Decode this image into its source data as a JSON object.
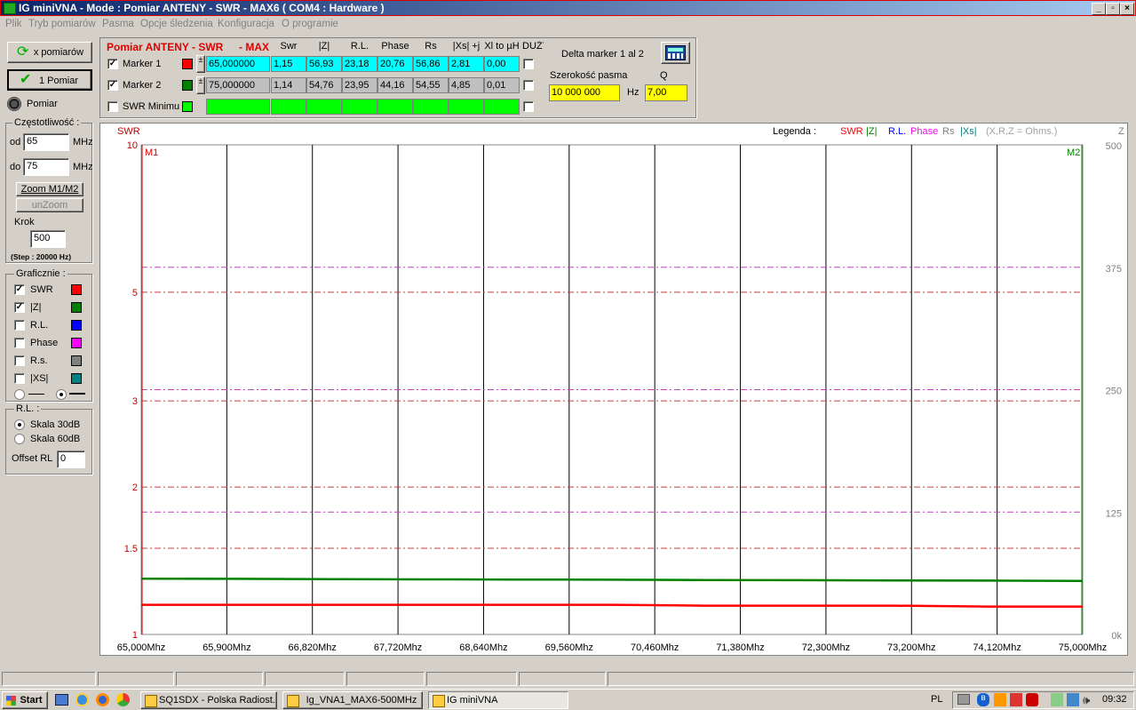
{
  "window": {
    "title": "IG miniVNA - Mode : Pomiar ANTENY - SWR    - MAX6 ( COM4 : Hardware )"
  },
  "menu": [
    "Plik",
    "Tryb pomiarów",
    "Pasma",
    "Opcje śledzenia",
    "Konfiguracja",
    "O programie"
  ],
  "left": {
    "x_pomiarow": "x pomiarów",
    "one_pomiar": "1 Pomiar",
    "pomiar": "Pomiar",
    "freq_title": "Częstotliwość :",
    "od_label": "od",
    "od_value": "65",
    "od_unit": "MHz",
    "do_label": "do",
    "do_value": "75",
    "do_unit": "MHz",
    "zoom": "Zoom M1/M2",
    "unzoom": "unZoom",
    "krok_label": "Krok",
    "krok_value": "500",
    "step_text": "(Step : 20000 Hz)",
    "graph_title": "Graficznie :",
    "graph_items": [
      {
        "label": "SWR",
        "checked": true,
        "color": "#ff0000"
      },
      {
        "label": "|Z|",
        "checked": true,
        "color": "#008000"
      },
      {
        "label": "R.L.",
        "checked": false,
        "color": "#0000ff"
      },
      {
        "label": "Phase",
        "checked": false,
        "color": "#ff00ff"
      },
      {
        "label": "R.s.",
        "checked": false,
        "color": "#808080"
      },
      {
        "label": "|XS|",
        "checked": false,
        "color": "#008080"
      }
    ],
    "rl_title": "R.L. :",
    "skala30": "Skala 30dB",
    "skala60": "Skala 60dB",
    "offset_label": "Offset RL",
    "offset_value": "0"
  },
  "markers": {
    "header_title": "Pomiar ANTENY - SWR",
    "header_max": "- MAX",
    "columns": [
      "Swr",
      "|Z|",
      "R.L.",
      "Phase",
      "Rs",
      "|Xs| +j",
      "Xl to µH",
      "DUŻY"
    ],
    "rows": [
      {
        "label": "Marker 1",
        "checked": true,
        "color": "#ff0000",
        "freq": "65,000000",
        "values": [
          "1,15",
          "56,93",
          "23,18",
          "20,76",
          "56,86",
          "2,81",
          "0,00"
        ]
      },
      {
        "label": "Marker 2",
        "checked": true,
        "color": "#008000",
        "freq": "75,000000",
        "values": [
          "1,14",
          "54,76",
          "23,95",
          "44,16",
          "54,55",
          "4,85",
          "0,01"
        ]
      },
      {
        "label": "SWR Minimu",
        "checked": false,
        "color": "#00ff00",
        "freq": "",
        "values": [
          "",
          "",
          "",
          "",
          "",
          "",
          ""
        ]
      }
    ],
    "delta_title": "Delta marker 1 al 2",
    "bandwidth_label": "Szerokość pasma",
    "bandwidth_value": "10 000 000",
    "bandwidth_unit": "Hz",
    "q_label": "Q",
    "q_value": "7,00"
  },
  "chart_data": {
    "type": "line",
    "left_axis_title": "SWR",
    "right_axis_title": "Z",
    "legend_prefix": "Legenda :",
    "legend": [
      {
        "name": "SWR",
        "color": "#ff0000"
      },
      {
        "name": "|Z|",
        "color": "#008000"
      },
      {
        "name": "R.L.",
        "color": "#0000ff"
      },
      {
        "name": "Phase",
        "color": "#ff00ff"
      },
      {
        "name": "Rs",
        "color": "#808080"
      },
      {
        "name": "|Xs|",
        "color": "#008080"
      }
    ],
    "legend_note": "(X,R,Z = Ohms.)",
    "swr_ticks": [
      "10",
      "5",
      "3",
      "2",
      "1.5",
      "1"
    ],
    "swr_tick_values": [
      10,
      5,
      3,
      2,
      1.5,
      1
    ],
    "z_ticks": [
      "500",
      "375",
      "250",
      "125",
      "0k"
    ],
    "z_tick_values": [
      500,
      375,
      250,
      125,
      0
    ],
    "x_ticks": [
      "65,000Mhz",
      "65,900Mhz",
      "66,820Mhz",
      "67,720Mhz",
      "68,640Mhz",
      "69,560Mhz",
      "70,460Mhz",
      "71,380Mhz",
      "72,300Mhz",
      "73,200Mhz",
      "74,120Mhz",
      "75,000Mhz"
    ],
    "xlim": [
      65,
      75
    ],
    "marker1_label": "M1",
    "marker2_label": "M2",
    "series": [
      {
        "name": "SWR",
        "color": "#ff0000",
        "x": [
          65,
          66,
          67,
          68,
          69,
          70,
          71,
          72,
          73,
          74,
          75
        ],
        "y": [
          1.15,
          1.15,
          1.15,
          1.15,
          1.15,
          1.15,
          1.145,
          1.145,
          1.145,
          1.14,
          1.14
        ]
      },
      {
        "name": "|Z|",
        "color": "#008000",
        "x": [
          65,
          66,
          67,
          68,
          69,
          70,
          71,
          72,
          73,
          74,
          75
        ],
        "y": [
          56.93,
          56.8,
          56.5,
          56.3,
          56.1,
          55.9,
          55.6,
          55.4,
          55.2,
          55.0,
          54.76
        ]
      }
    ]
  },
  "taskbar": {
    "start": "Start",
    "tasks": [
      "SQ1SDX - Polska Radiost...",
      "Ig_VNA1_MAX6-500MHz",
      "IG miniVNA"
    ],
    "lang": "PL",
    "time": "09:32"
  }
}
